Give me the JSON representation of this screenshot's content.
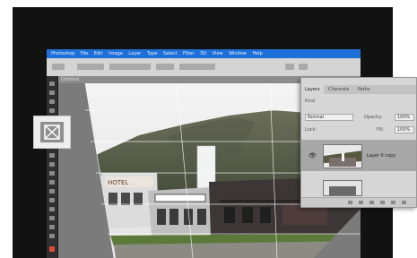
{
  "app": {
    "menu_items": [
      "Photoshop",
      "File",
      "Edit",
      "Image",
      "Layer",
      "Type",
      "Select",
      "Filter",
      "3D",
      "View",
      "Window",
      "Help"
    ],
    "document_tab": "Untitled"
  },
  "crop_overlay": {
    "icon": "perspective-crop-icon"
  },
  "layers_panel": {
    "tabs": [
      "Layers",
      "Channels",
      "Paths"
    ],
    "kind_label": "Kind",
    "blend_mode": "Normal",
    "opacity_label": "Opacity:",
    "opacity_value": "100%",
    "lock_label": "Lock:",
    "fill_label": "Fill:",
    "fill_value": "100%",
    "visibility_icon": "eye-icon",
    "layer_name": "Layer 0 copy"
  },
  "colors": {
    "menubar": "#1f6fd8",
    "panel_bg": "#d6d6d6",
    "selected_layer": "#a7a7a7"
  }
}
